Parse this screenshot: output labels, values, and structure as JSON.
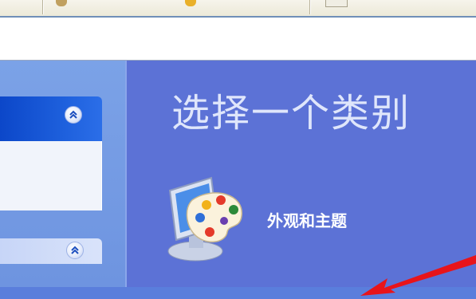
{
  "main": {
    "heading": "选择一个类别",
    "categories": [
      {
        "label": "外观和主题",
        "icon": "appearance-themes-icon"
      }
    ]
  },
  "sidebar": {
    "panels": [
      {
        "icon": "collapse-chevron-icon"
      },
      {
        "icon": "collapse-chevron-icon"
      }
    ]
  },
  "colors": {
    "main_bg": "#5c72d6",
    "sidebar_bg": "#7ba2e7",
    "panel_header": "#1d5fdc",
    "arrow": "#e8141a"
  }
}
